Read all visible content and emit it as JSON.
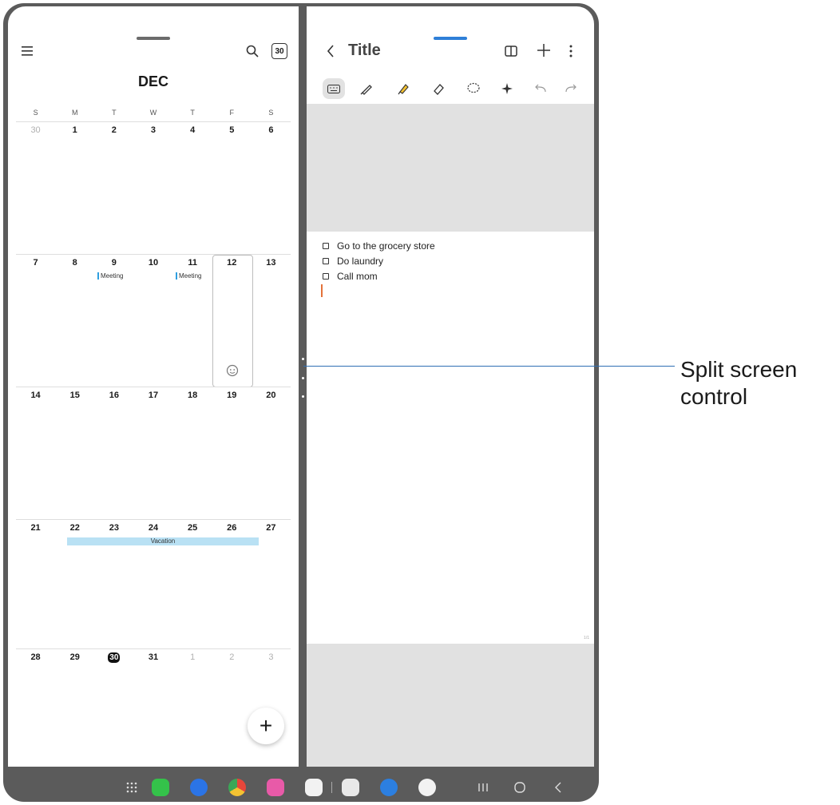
{
  "calendar": {
    "month": "DEC",
    "today_badge": "30",
    "weekdays": [
      "S",
      "M",
      "T",
      "W",
      "T",
      "F",
      "S"
    ],
    "weeks": [
      [
        "30",
        "1",
        "2",
        "3",
        "4",
        "5",
        "6"
      ],
      [
        "7",
        "8",
        "9",
        "10",
        "11",
        "12",
        "13"
      ],
      [
        "14",
        "15",
        "16",
        "17",
        "18",
        "19",
        "20"
      ],
      [
        "21",
        "22",
        "23",
        "24",
        "25",
        "26",
        "27"
      ],
      [
        "28",
        "29",
        "30",
        "31",
        "1",
        "2",
        "3"
      ]
    ],
    "events": {
      "meeting_1": "Meeting",
      "meeting_2": "Meeting",
      "vacation": "Vacation"
    },
    "fab_label": "+"
  },
  "notes": {
    "title": "Title",
    "tasks": [
      "Go to the grocery store",
      "Do laundry",
      "Call mom"
    ],
    "page_indicator": "1/1"
  },
  "annotation": {
    "line1": "Split screen",
    "line2": "control"
  },
  "colors": {
    "accent": "#2f7fd8",
    "event_bar": "#2f9fe0",
    "vacation": "#b9e1f4",
    "callout": "#2f6fb4"
  }
}
